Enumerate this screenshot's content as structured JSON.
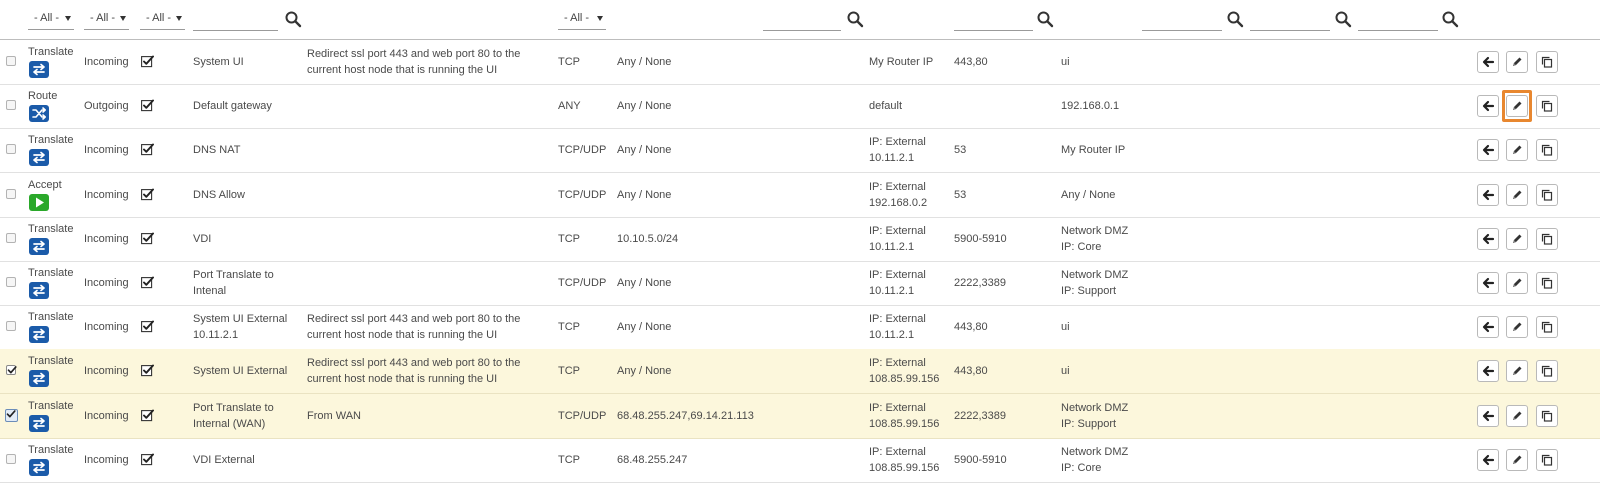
{
  "filters": {
    "action_select": "- All -",
    "direction_select": "- All -",
    "enabled_select": "- All -",
    "protocol_select": "- All -"
  },
  "rows": [
    {
      "action": "Translate",
      "action_icon": "swap-icon",
      "direction": "Incoming",
      "enabled": true,
      "name": "System UI",
      "description": "Redirect ssl port 443 and web port 80 to the current host node that is running the UI",
      "protocol": "TCP",
      "source": "Any / None",
      "destination": "My Router IP",
      "port": "443,80",
      "target": "ui",
      "selected": false
    },
    {
      "action": "Route",
      "action_icon": "shuffle-icon",
      "direction": "Outgoing",
      "enabled": true,
      "name": "Default gateway",
      "description": "",
      "protocol": "ANY",
      "source": "Any / None",
      "destination": "default",
      "port": "",
      "target": "192.168.0.1",
      "selected": false
    },
    {
      "action": "Translate",
      "action_icon": "swap-icon",
      "direction": "Incoming",
      "enabled": true,
      "name": "DNS NAT",
      "description": "",
      "protocol": "TCP/UDP",
      "source": "Any / None",
      "destination": "IP: External 10.11.2.1",
      "port": "53",
      "target": "My Router IP",
      "selected": false
    },
    {
      "action": "Accept",
      "action_icon": "play-icon",
      "direction": "Incoming",
      "enabled": true,
      "name": "DNS Allow",
      "description": "",
      "protocol": "TCP/UDP",
      "source": "Any / None",
      "destination": "IP: External 192.168.0.2",
      "port": "53",
      "target": "Any / None",
      "selected": false
    },
    {
      "action": "Translate",
      "action_icon": "swap-icon",
      "direction": "Incoming",
      "enabled": true,
      "name": "VDI",
      "description": "",
      "protocol": "TCP",
      "source": "10.10.5.0/24",
      "destination": "IP: External 10.11.2.1",
      "port": "5900-5910",
      "target": "Network DMZ IP: Core",
      "selected": false
    },
    {
      "action": "Translate",
      "action_icon": "swap-icon",
      "direction": "Incoming",
      "enabled": true,
      "name": "Port Translate to Intenal",
      "description": "",
      "protocol": "TCP/UDP",
      "source": "Any / None",
      "destination": "IP: External 10.11.2.1",
      "port": "2222,3389",
      "target": "Network DMZ IP: Support",
      "selected": false
    },
    {
      "action": "Translate",
      "action_icon": "swap-icon",
      "direction": "Incoming",
      "enabled": true,
      "name": "System UI External 10.11.2.1",
      "description": "Redirect ssl port 443 and web port 80 to the current host node that is running the UI",
      "protocol": "TCP",
      "source": "Any / None",
      "destination": "IP: External 10.11.2.1",
      "port": "443,80",
      "target": "ui",
      "selected": false
    },
    {
      "action": "Translate",
      "action_icon": "swap-icon",
      "direction": "Incoming",
      "enabled": true,
      "name": "System UI External",
      "description": "Redirect ssl port 443 and web port 80 to the current host node that is running the UI",
      "protocol": "TCP",
      "source": "Any / None",
      "destination": "IP: External 108.85.99.156",
      "port": "443,80",
      "target": "ui",
      "selected": true
    },
    {
      "action": "Translate",
      "action_icon": "swap-icon",
      "direction": "Incoming",
      "enabled": true,
      "name": "Port Translate to Internal (WAN)",
      "description": "From WAN",
      "protocol": "TCP/UDP",
      "source": "68.48.255.247,69.14.21.113",
      "destination": "IP: External 108.85.99.156",
      "port": "2222,3389",
      "target": "Network DMZ IP: Support",
      "selected": true
    },
    {
      "action": "Translate",
      "action_icon": "swap-icon",
      "direction": "Incoming",
      "enabled": true,
      "name": "VDI External",
      "description": "",
      "protocol": "TCP",
      "source": "68.48.255.247",
      "destination": "IP: External 108.85.99.156",
      "port": "5900-5910",
      "target": "Network DMZ IP: Core",
      "selected": false
    }
  ],
  "row_buttons": [
    "arrow-left-icon",
    "pencil-icon",
    "copy-icon"
  ],
  "colors": {
    "badge_blue": "#1b5ba9",
    "badge_green": "#2aa82a",
    "selected_row": "#fcf7dc",
    "highlight": "#e8872f"
  }
}
